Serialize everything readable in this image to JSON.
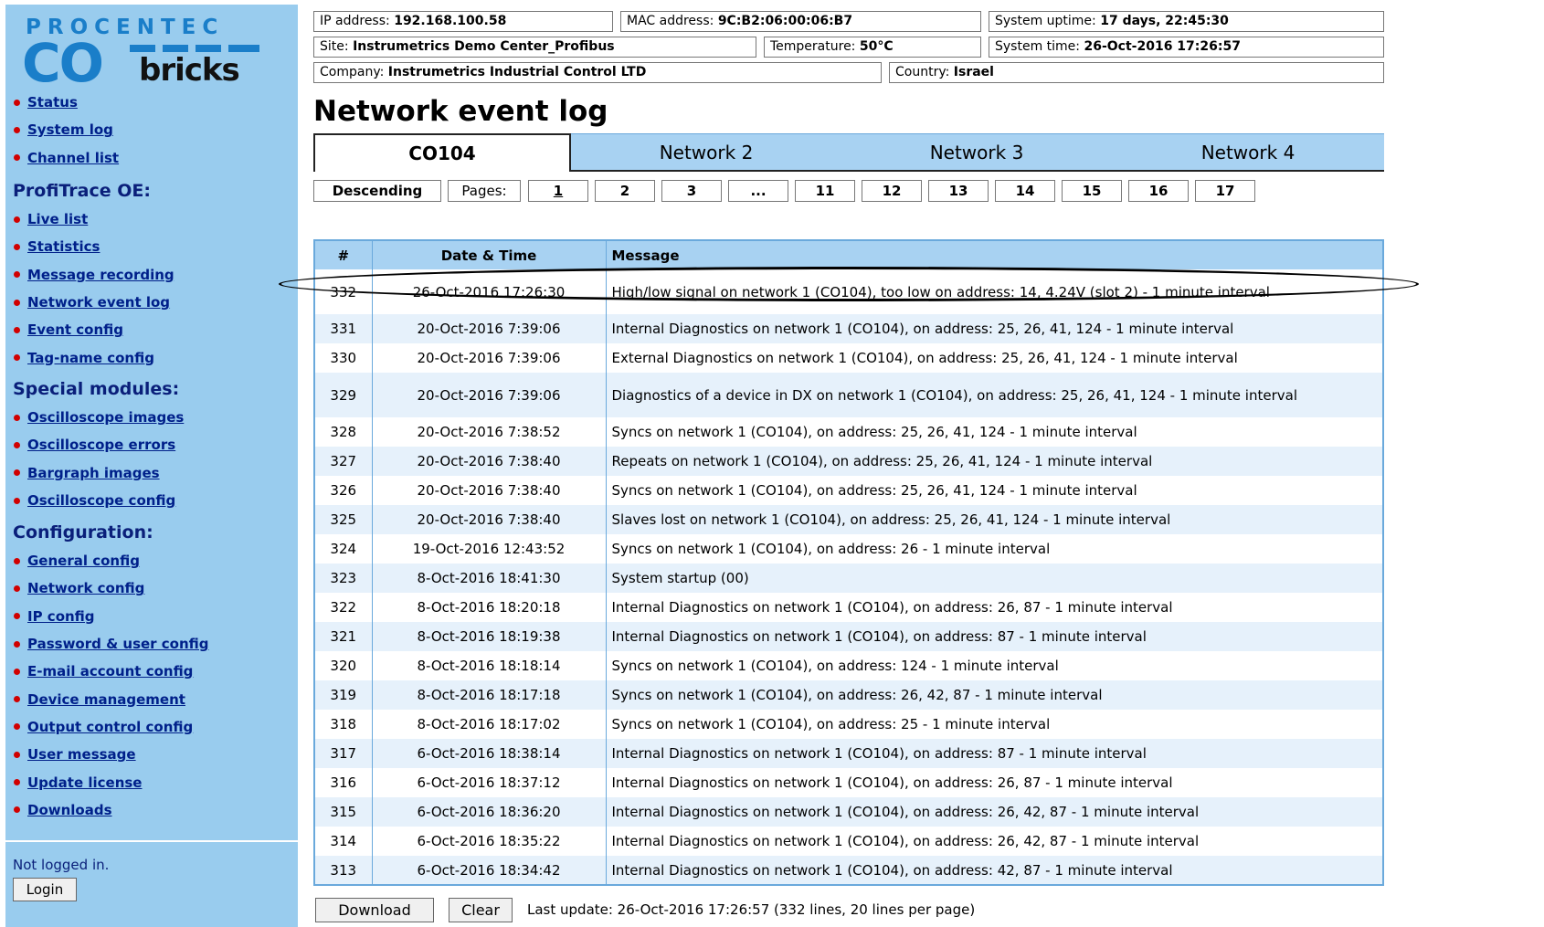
{
  "logo": {
    "wordmark": "PROCENTEC",
    "co": "CO",
    "bricks": "bricks"
  },
  "header": {
    "ip": {
      "label": "IP address:",
      "value": "192.168.100.58"
    },
    "mac": {
      "label": "MAC address:",
      "value": "9C:B2:06:00:06:B7"
    },
    "uptime": {
      "label": "System uptime:",
      "value": "17 days, 22:45:30"
    },
    "site": {
      "label": "Site:",
      "value": "Instrumetrics Demo Center_Profibus"
    },
    "temperature": {
      "label": "Temperature:",
      "value": "50°C"
    },
    "system_time": {
      "label": "System time:",
      "value": "26-Oct-2016 17:26:57"
    },
    "company": {
      "label": "Company:",
      "value": "Instrumetrics Industrial Control LTD"
    },
    "country": {
      "label": "Country:",
      "value": "Israel"
    }
  },
  "sidebar": {
    "top_links": [
      "Status",
      "System log",
      "Channel list"
    ],
    "profitrace_heading": "ProfiTrace OE:",
    "profitrace_links": [
      "Live list",
      "Statistics",
      "Message recording",
      "Network event log",
      "Event config",
      "Tag-name config"
    ],
    "special_heading": "Special modules:",
    "special_links": [
      "Oscilloscope images",
      "Oscilloscope errors",
      "Bargraph images",
      "Oscilloscope config"
    ],
    "config_heading": "Configuration:",
    "config_links": [
      "General config",
      "Network config",
      "IP config",
      "Password & user config",
      "E-mail account config",
      "Device management",
      "Output control config",
      "User message",
      "Update license",
      "Downloads"
    ],
    "login_status": "Not logged in.",
    "login_button": "Login"
  },
  "page_title": "Network event log",
  "tabs": [
    "CO104",
    "Network 2",
    "Network 3",
    "Network 4"
  ],
  "active_tab": 0,
  "pager": {
    "sort_label": "Descending",
    "pages_label": "Pages:",
    "pages": [
      "1",
      "2",
      "3",
      "...",
      "11",
      "12",
      "13",
      "14",
      "15",
      "16",
      "17"
    ],
    "current_page": "1"
  },
  "table": {
    "headers": [
      "#",
      "Date & Time",
      "Message"
    ],
    "rows": [
      [
        "332",
        "26-Oct-2016 17:26:30",
        "High/low signal on network 1 (CO104), too low on address: 14, 4.24V (slot 2) - 1 minute interval"
      ],
      [
        "331",
        "20-Oct-2016 7:39:06",
        "Internal Diagnostics on network 1 (CO104), on address: 25, 26, 41, 124 - 1 minute interval"
      ],
      [
        "330",
        "20-Oct-2016 7:39:06",
        "External Diagnostics on network 1 (CO104), on address: 25, 26, 41, 124 - 1 minute interval"
      ],
      [
        "329",
        "20-Oct-2016 7:39:06",
        "Diagnostics of a device in DX on network 1 (CO104), on address: 25, 26, 41, 124 - 1 minute interval"
      ],
      [
        "328",
        "20-Oct-2016 7:38:52",
        "Syncs on network 1 (CO104), on address: 25, 26, 41, 124 - 1 minute interval"
      ],
      [
        "327",
        "20-Oct-2016 7:38:40",
        "Repeats on network 1 (CO104), on address: 25, 26, 41, 124 - 1 minute interval"
      ],
      [
        "326",
        "20-Oct-2016 7:38:40",
        "Syncs on network 1 (CO104), on address: 25, 26, 41, 124 - 1 minute interval"
      ],
      [
        "325",
        "20-Oct-2016 7:38:40",
        "Slaves lost on network 1 (CO104), on address: 25, 26, 41, 124 - 1 minute interval"
      ],
      [
        "324",
        "19-Oct-2016 12:43:52",
        "Syncs on network 1 (CO104), on address: 26 - 1 minute interval"
      ],
      [
        "323",
        "8-Oct-2016 18:41:30",
        "System startup (00)"
      ],
      [
        "322",
        "8-Oct-2016 18:20:18",
        "Internal Diagnostics on network 1 (CO104), on address: 26, 87 - 1 minute interval"
      ],
      [
        "321",
        "8-Oct-2016 18:19:38",
        "Internal Diagnostics on network 1 (CO104), on address: 87 - 1 minute interval"
      ],
      [
        "320",
        "8-Oct-2016 18:18:14",
        "Syncs on network 1 (CO104), on address: 124 - 1 minute interval"
      ],
      [
        "319",
        "8-Oct-2016 18:17:18",
        "Syncs on network 1 (CO104), on address: 26, 42, 87 - 1 minute interval"
      ],
      [
        "318",
        "8-Oct-2016 18:17:02",
        "Syncs on network 1 (CO104), on address: 25 - 1 minute interval"
      ],
      [
        "317",
        "6-Oct-2016 18:38:14",
        "Internal Diagnostics on network 1 (CO104), on address: 87 - 1 minute interval"
      ],
      [
        "316",
        "6-Oct-2016 18:37:12",
        "Internal Diagnostics on network 1 (CO104), on address: 26, 87 - 1 minute interval"
      ],
      [
        "315",
        "6-Oct-2016 18:36:20",
        "Internal Diagnostics on network 1 (CO104), on address: 26, 42, 87 - 1 minute interval"
      ],
      [
        "314",
        "6-Oct-2016 18:35:22",
        "Internal Diagnostics on network 1 (CO104), on address: 26, 42, 87 - 1 minute interval"
      ],
      [
        "313",
        "6-Oct-2016 18:34:42",
        "Internal Diagnostics on network 1 (CO104), on address: 42, 87 - 1 minute interval"
      ]
    ]
  },
  "footer": {
    "download_label": "Download",
    "clear_label": "Clear",
    "last_update": "Last update: 26-Oct-2016 17:26:57 (332 lines, 20 lines per page)"
  },
  "colors": {
    "sidebar_bg": "#99ccee",
    "tab_bg": "#a8d2f2",
    "link": "#00208a",
    "bullet": "#d10000",
    "brand_blue": "#1a7ec9"
  }
}
